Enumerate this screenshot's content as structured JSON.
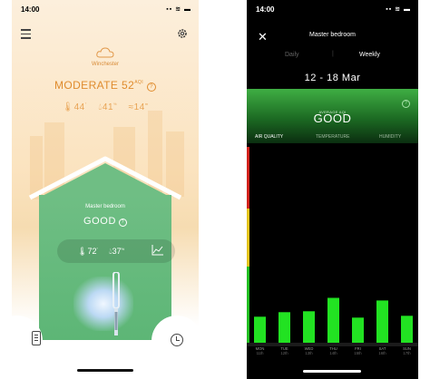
{
  "left_screen": {
    "status_time": "14:00",
    "status_icons": "▪▪ ≋ ▬",
    "city": "Winchester",
    "outdoor_level": "MODERATE",
    "outdoor_aqi": "52",
    "aqi_superscript": "AQI",
    "outdoor_readings": {
      "temp": "44",
      "humidity": "41",
      "wind": "14"
    },
    "room_name": "Master bedroom",
    "room_status": "GOOD",
    "indoor_readings": {
      "temp": "72",
      "humidity": "37"
    },
    "icons": [
      "menu-icon",
      "cloud-icon",
      "gear-icon",
      "info-icon",
      "chart-icon",
      "remote-icon",
      "clock-icon"
    ],
    "colors": {
      "outdoor_accent": "#e08c2e",
      "house_green": "#5db676"
    }
  },
  "right_screen": {
    "status_time": "14:00",
    "title": "Master bedroom",
    "tabs": {
      "daily": "Daily",
      "weekly": "Weekly",
      "active": "Weekly"
    },
    "date_range": "12 - 18 Mar",
    "average_label": "AVERAGE AQI",
    "average_value": "GOOD",
    "metric_tabs": {
      "air_quality": "AIR QUALITY",
      "temperature": "TEMPERATURE",
      "humidity": "HUMIDITY",
      "active": "AIR QUALITY"
    },
    "colors": {
      "bar": "#22e222",
      "panel": "#2f9a36",
      "scale_red": "#d3231c",
      "scale_yellow": "#e4c41c",
      "scale_green": "#22c022"
    }
  },
  "chart_data": {
    "type": "bar",
    "categories": [
      "MON 11th",
      "TUE 12th",
      "WED 13th",
      "THU 14th",
      "FRI 15th",
      "SAT 16th",
      "SUN 17th"
    ],
    "day_labels": [
      "MON",
      "TUE",
      "WED",
      "THU",
      "FRI",
      "SAT",
      "SUN"
    ],
    "date_labels": [
      "11th",
      "12th",
      "13th",
      "14th",
      "15th",
      "16th",
      "17th"
    ],
    "values": [
      29,
      34,
      35,
      50,
      28,
      47,
      30
    ],
    "ylim": [
      0,
      220
    ],
    "scale_bands": [
      "red",
      "yellow",
      "green"
    ]
  }
}
